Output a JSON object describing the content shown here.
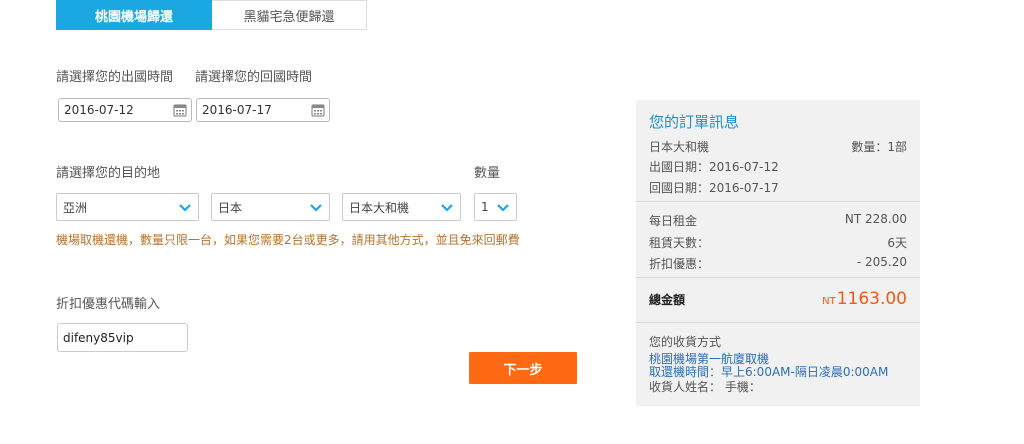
{
  "tabs": [
    {
      "label": "桃園機場歸還",
      "active": true
    },
    {
      "label": "黑貓宅急便歸還",
      "active": false
    }
  ],
  "dates": {
    "depart_label": "請選擇您的出國時間",
    "return_label": "請選擇您的回國時間",
    "depart_value": "2016-07-12",
    "return_value": "2016-07-17"
  },
  "destination": {
    "label": "請選擇您的目的地",
    "region": "亞洲",
    "country": "日本",
    "plan": "日本大和機"
  },
  "quantity": {
    "label": "數量",
    "value": "1"
  },
  "notice": "機場取機還機，數量只限一台，如果您需要2台或更多，請用其他方式，並且免來回郵費",
  "coupon": {
    "label": "折扣優惠代碼輸入",
    "value": "difeny85vip"
  },
  "next_button": "下一步",
  "order": {
    "title": "您的訂單訊息",
    "product": "日本大和機",
    "quantity_text": "數量：1部",
    "depart_text": "出國日期：2016-07-12",
    "return_text": "回國日期：2016-07-17",
    "daily_label": "每日租金",
    "daily_value": "NT 228.00",
    "days_label": "租賃天數：",
    "days_value": "6天",
    "discount_label": "折扣優惠：",
    "discount_value": "- 205.20",
    "total_label": "總金額",
    "total_currency": "NT",
    "total_value": "1163.00",
    "delivery_label": "您的收貨方式",
    "delivery_place": "桃園機場第一航廈取機",
    "delivery_time": "取還機時間：早上6:00AM-隔日凌晨0:00AM",
    "recipient": "收貨人姓名：  手機："
  },
  "colors": {
    "tab_active": "#1aa7e2",
    "button": "#ff6a13",
    "notice": "#b7722a",
    "accent_blue": "#1d8fd1",
    "total": "#f05a14"
  },
  "icons": {
    "calendar": "calendar-icon",
    "dropdown": "chevron-down-icon"
  }
}
